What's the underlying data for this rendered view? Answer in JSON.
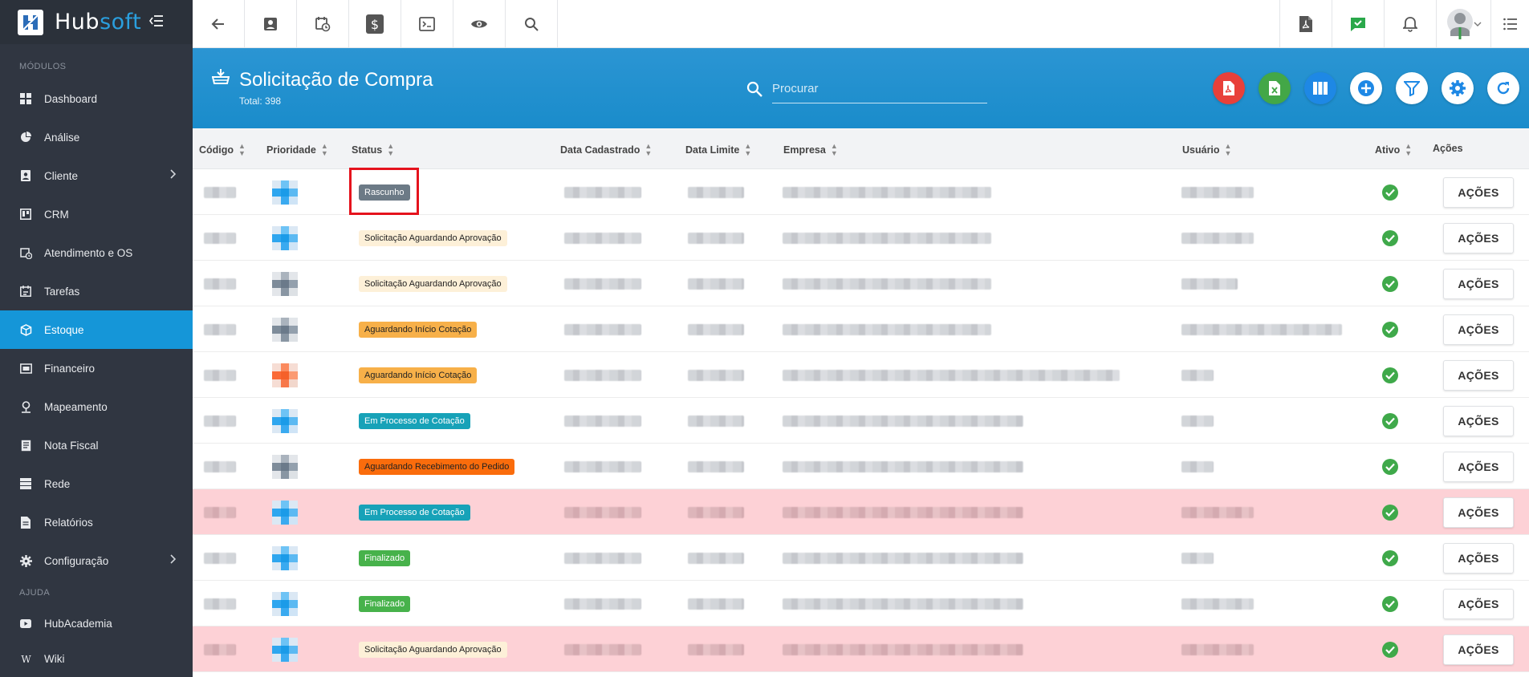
{
  "brand": {
    "name_hub": "Hub",
    "name_soft": "soft"
  },
  "sidebar": {
    "section_modules": "MÓDULOS",
    "items": [
      {
        "label": "Dashboard",
        "icon": "dashboard-icon"
      },
      {
        "label": "Análise",
        "icon": "pie-chart-icon"
      },
      {
        "label": "Cliente",
        "icon": "contact-card-icon",
        "has_submenu": true
      },
      {
        "label": "CRM",
        "icon": "crm-board-icon"
      },
      {
        "label": "Atendimento e OS",
        "icon": "calendar-clock-icon"
      },
      {
        "label": "Tarefas",
        "icon": "tasks-icon"
      },
      {
        "label": "Estoque",
        "icon": "cube-icon",
        "active": true
      },
      {
        "label": "Financeiro",
        "icon": "money-icon"
      },
      {
        "label": "Mapeamento",
        "icon": "map-pin-icon"
      },
      {
        "label": "Nota Fiscal",
        "icon": "receipt-icon"
      },
      {
        "label": "Rede",
        "icon": "server-icon"
      },
      {
        "label": "Relatórios",
        "icon": "report-icon"
      },
      {
        "label": "Configuração",
        "icon": "gear-icon",
        "has_submenu": true
      }
    ],
    "section_help": "AJUDA",
    "help_items": [
      {
        "label": "HubAcademia",
        "icon": "youtube-icon"
      },
      {
        "label": "Wiki",
        "icon": "wikipedia-icon"
      }
    ]
  },
  "header": {
    "title": "Solicitação de Compra",
    "total": "Total: 398",
    "search_placeholder": "Procurar"
  },
  "colors": {
    "sidebar_bg": "#303641",
    "accent": "#1596d8",
    "header_bg": "#1a8ccb",
    "pdf": "#e8403a",
    "excel": "#43a747",
    "action_blue": "#1e88e5",
    "highlight_row": "#fdd1d6",
    "check_green": "#3fa94a"
  },
  "table": {
    "columns": [
      "Código",
      "Prioridade",
      "Status",
      "Data Cadastrado",
      "Data Limite",
      "Empresa",
      "Usuário",
      "Ativo",
      "Ações"
    ],
    "action_label": "AÇÕES",
    "rows": [
      {
        "status": "Rascunho",
        "status_style": "gray",
        "priority": "blue",
        "highlight": false,
        "active": true
      },
      {
        "status": "Solicitação Aguardando Aprovação",
        "status_style": "cream",
        "priority": "blue",
        "highlight": false,
        "active": true
      },
      {
        "status": "Solicitação Aguardando Aprovação",
        "status_style": "cream",
        "priority": "slate",
        "highlight": false,
        "active": true
      },
      {
        "status": "Aguardando Início Cotação",
        "status_style": "orange",
        "priority": "slate",
        "highlight": false,
        "active": true
      },
      {
        "status": "Aguardando Início Cotação",
        "status_style": "orange",
        "priority": "red",
        "highlight": false,
        "active": true
      },
      {
        "status": "Em Processo de Cotação",
        "status_style": "teal",
        "priority": "blue",
        "highlight": false,
        "active": true
      },
      {
        "status": "Aguardando Recebimento do Pedido",
        "status_style": "deep",
        "priority": "slate",
        "highlight": false,
        "active": true
      },
      {
        "status": "Em Processo de Cotação",
        "status_style": "teal",
        "priority": "blue",
        "highlight": true,
        "active": true
      },
      {
        "status": "Finalizado",
        "status_style": "green",
        "priority": "blue",
        "highlight": false,
        "active": true
      },
      {
        "status": "Finalizado",
        "status_style": "green",
        "priority": "blue",
        "highlight": false,
        "active": true
      },
      {
        "status": "Solicitação Aguardando Aprovação",
        "status_style": "cream",
        "priority": "blue",
        "highlight": true,
        "active": true
      }
    ]
  }
}
